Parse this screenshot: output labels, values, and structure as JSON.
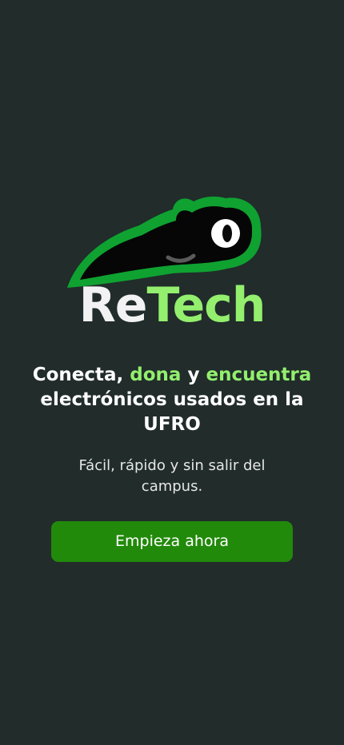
{
  "brand": {
    "name_part1": "Re",
    "name_part2": "Tech"
  },
  "headline": {
    "part1": "Conecta, ",
    "accent1": "dona",
    "part2": " y ",
    "accent2": "encuentra",
    "part3": " electrónicos usados en la UFRO"
  },
  "subtitle": "Fácil, rápido y sin salir del campus.",
  "cta": {
    "label": "Empieza ahora"
  },
  "colors": {
    "background": "#212c2b",
    "accent": "#93ef6d",
    "logo_green": "#0fa231",
    "button": "#228a0b"
  },
  "icons": [
    "tadpole-mascot-icon"
  ]
}
